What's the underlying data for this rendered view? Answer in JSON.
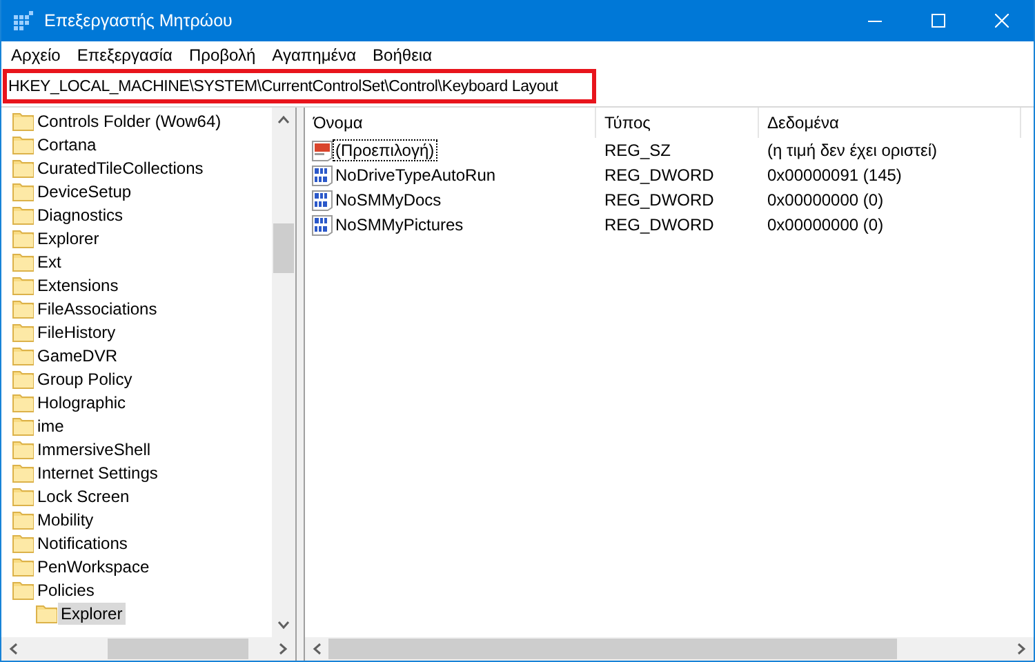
{
  "window": {
    "title": "Επεξεργαστής Μητρώου"
  },
  "menu": [
    "Αρχείο",
    "Επεξεργασία",
    "Προβολή",
    "Αγαπημένα",
    "Βοήθεια"
  ],
  "address": {
    "value": "HKEY_LOCAL_MACHINE\\SYSTEM\\CurrentControlSet\\Control\\Keyboard Layout",
    "highlighted": true
  },
  "tree": [
    {
      "label": "Controls Folder (Wow64)",
      "selected": false
    },
    {
      "label": "Cortana",
      "selected": false
    },
    {
      "label": "CuratedTileCollections",
      "selected": false
    },
    {
      "label": "DeviceSetup",
      "selected": false
    },
    {
      "label": "Diagnostics",
      "selected": false
    },
    {
      "label": "Explorer",
      "selected": false
    },
    {
      "label": "Ext",
      "selected": false
    },
    {
      "label": "Extensions",
      "selected": false
    },
    {
      "label": "FileAssociations",
      "selected": false
    },
    {
      "label": "FileHistory",
      "selected": false
    },
    {
      "label": "GameDVR",
      "selected": false
    },
    {
      "label": "Group Policy",
      "selected": false
    },
    {
      "label": "Holographic",
      "selected": false
    },
    {
      "label": "ime",
      "selected": false
    },
    {
      "label": "ImmersiveShell",
      "selected": false
    },
    {
      "label": "Internet Settings",
      "selected": false
    },
    {
      "label": "Lock Screen",
      "selected": false
    },
    {
      "label": "Mobility",
      "selected": false
    },
    {
      "label": "Notifications",
      "selected": false
    },
    {
      "label": "PenWorkspace",
      "selected": false
    },
    {
      "label": "Policies",
      "selected": false,
      "children": [
        {
          "label": "Explorer",
          "selected": true
        }
      ]
    }
  ],
  "table": {
    "columns": [
      "Όνομα",
      "Τύπος",
      "Δεδομένα"
    ],
    "rows": [
      {
        "kind": "string",
        "name": "(Προεπιλογή)",
        "type": "REG_SZ",
        "data": "(η τιμή δεν έχει οριστεί)",
        "focused": true
      },
      {
        "kind": "dword",
        "name": "NoDriveTypeAutoRun",
        "type": "REG_DWORD",
        "data": "0x00000091 (145)",
        "focused": false
      },
      {
        "kind": "dword",
        "name": "NoSMMyDocs",
        "type": "REG_DWORD",
        "data": "0x00000000 (0)",
        "focused": false
      },
      {
        "kind": "dword",
        "name": "NoSMMyPictures",
        "type": "REG_DWORD",
        "data": "0x00000000 (0)",
        "focused": false
      }
    ]
  }
}
